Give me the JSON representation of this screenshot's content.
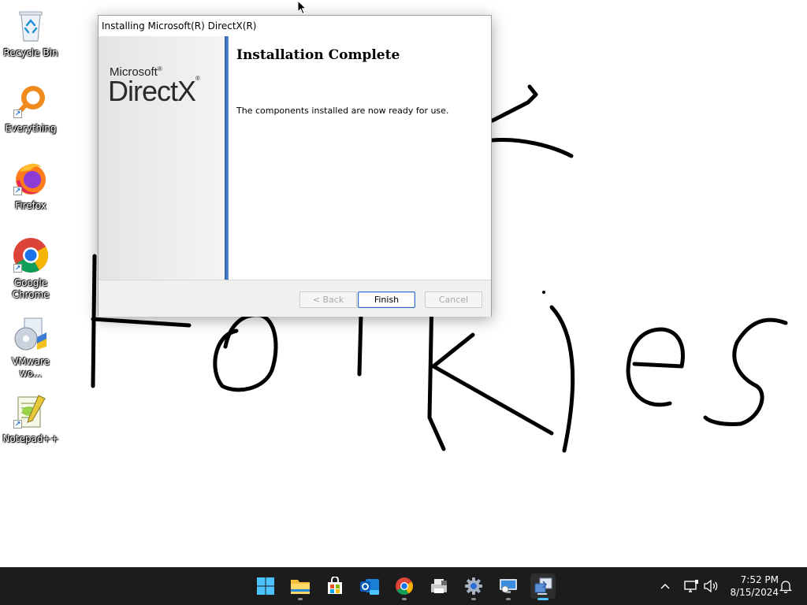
{
  "desktop": {
    "icons": [
      {
        "label": "Recycle Bin",
        "icon": "recycle-bin-icon"
      },
      {
        "label": "Everything",
        "icon": "everything-search-icon"
      },
      {
        "label": "Firefox",
        "icon": "firefox-icon"
      },
      {
        "label": "Google Chrome",
        "icon": "chrome-icon"
      },
      {
        "label": "VMware wo...",
        "icon": "vmware-workstation-icon"
      },
      {
        "label": "Notepad++",
        "icon": "notepadpp-icon"
      }
    ],
    "background_color": "#ffffff",
    "doodle_color": "#000000"
  },
  "dialog": {
    "title": "Installing Microsoft(R) DirectX(R)",
    "logo_top": "Microsoft",
    "logo_main": "DirectX",
    "heading": "Installation Complete",
    "message": "The components installed are now ready for use.",
    "buttons": {
      "back": "< Back",
      "finish": "Finish",
      "cancel": "Cancel"
    },
    "accent_color": "#2c5fa8"
  },
  "taskbar": {
    "apps": [
      {
        "name": "start-button",
        "icon": "windows-start-icon"
      },
      {
        "name": "file-explorer",
        "icon": "folder-icon"
      },
      {
        "name": "microsoft-store",
        "icon": "store-icon"
      },
      {
        "name": "outlook-new",
        "icon": "outlook-icon"
      },
      {
        "name": "chrome",
        "icon": "chrome-icon"
      },
      {
        "name": "app-generic",
        "icon": "printer-icon"
      },
      {
        "name": "settings",
        "icon": "gear-icon"
      },
      {
        "name": "remote-desktop",
        "icon": "monitor-icon"
      },
      {
        "name": "directx-setup",
        "icon": "setup-icon"
      }
    ],
    "time": "7:52 PM",
    "date": "8/15/2024",
    "background_color": "#1c1c1c"
  }
}
